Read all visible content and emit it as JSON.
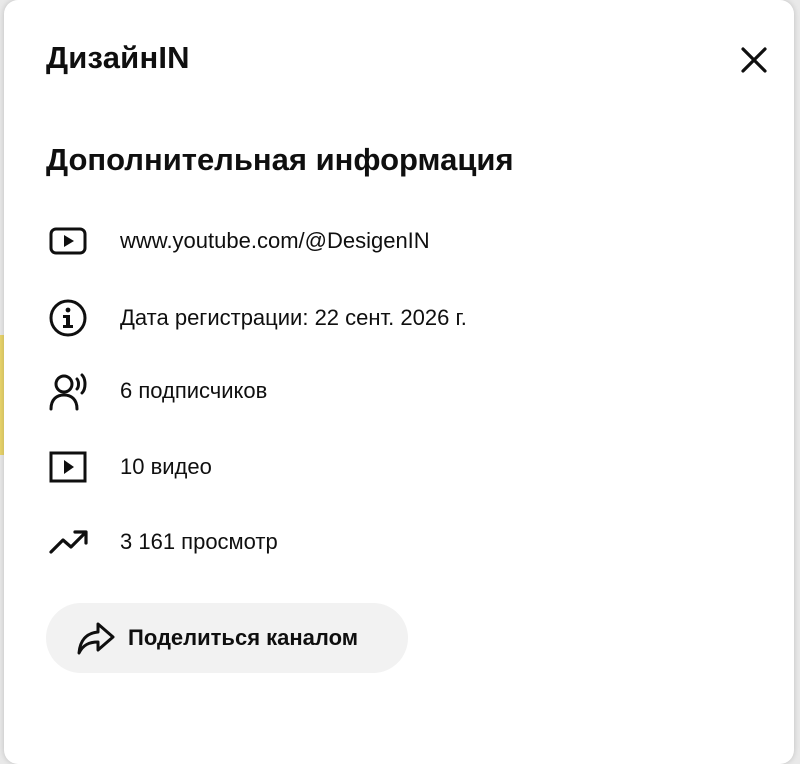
{
  "dialog": {
    "channel_name": "ДизайнIN",
    "close_icon": "close-icon",
    "section_title": "Дополнительная информация",
    "items": [
      {
        "icon": "video-link-icon",
        "text": "www.youtube.com/@DesigenIN"
      },
      {
        "icon": "info-icon",
        "text": "Дата регистрации: 22 сент. 2026 г."
      },
      {
        "icon": "subscribers-icon",
        "text": "6 подписчиков"
      },
      {
        "icon": "videos-icon",
        "text": "10 видео"
      },
      {
        "icon": "trending-up-icon",
        "text": "3 161 просмотр"
      }
    ],
    "share_button": {
      "icon": "share-icon",
      "label": "Поделиться каналом"
    }
  },
  "colors": {
    "background": "#ffffff",
    "text": "#0f0f0f",
    "button_bg": "#f2f2f2",
    "edge_accent": "#e9d46b"
  }
}
